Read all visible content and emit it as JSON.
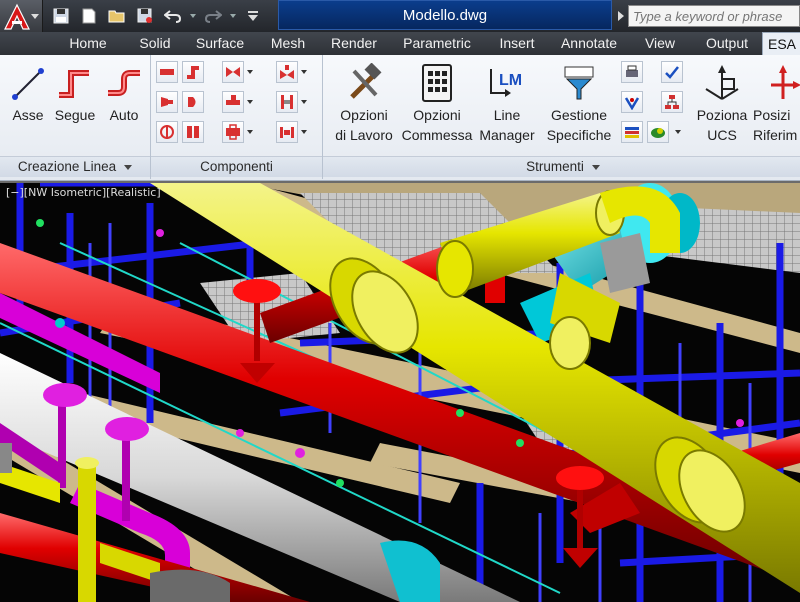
{
  "document_title": "Modello.dwg",
  "search": {
    "placeholder": "Type a keyword or phrase"
  },
  "quick_access": [
    {
      "name": "save-icon"
    },
    {
      "name": "new-file-icon"
    },
    {
      "name": "open-folder-icon"
    },
    {
      "name": "save-as-icon"
    },
    {
      "name": "undo-icon"
    },
    {
      "name": "redo-icon"
    },
    {
      "name": "customize-icon"
    }
  ],
  "tabs": [
    "Home",
    "Solid",
    "Surface",
    "Mesh",
    "Render",
    "Parametric",
    "Insert",
    "Annotate",
    "View",
    "Output",
    "ESA"
  ],
  "active_tab": "ESA",
  "panels": {
    "creazione_linea": {
      "title": "Creazione Linea",
      "buttons": [
        {
          "label": "Asse",
          "icon": "axis-line-icon"
        },
        {
          "label": "Segue",
          "icon": "follow-pipe-icon"
        },
        {
          "label": "Auto",
          "icon": "auto-route-icon"
        }
      ]
    },
    "componenti": {
      "title": "Componenti"
    },
    "strumenti": {
      "title": "Strumenti",
      "buttons": [
        {
          "label_1": "Opzioni",
          "label_2": "di Lavoro",
          "icon": "tools-hammer-icon"
        },
        {
          "label_1": "Opzioni",
          "label_2": "Commessa",
          "icon": "calculator-icon"
        },
        {
          "label_1": "Line",
          "label_2": "Manager",
          "icon": "line-manager-icon"
        },
        {
          "label_1": "Gestione",
          "label_2": "Specifiche",
          "icon": "spec-manager-icon"
        },
        {
          "label_1": "Poziona",
          "label_2": "UCS",
          "icon": "ucs-icon"
        },
        {
          "label_1": "Posizi",
          "label_2": "Riferim",
          "icon": "reference-icon"
        }
      ]
    }
  },
  "viewport": {
    "label": "[−][NW Isometric][Realistic]"
  },
  "colors": {
    "accent": "#0b3d8c",
    "pipe_yellow": "#e8e800",
    "pipe_red": "#e00000",
    "structure_blue": "#1a1ae6",
    "magenta": "#d800d8",
    "cyan": "#00d8d8"
  }
}
